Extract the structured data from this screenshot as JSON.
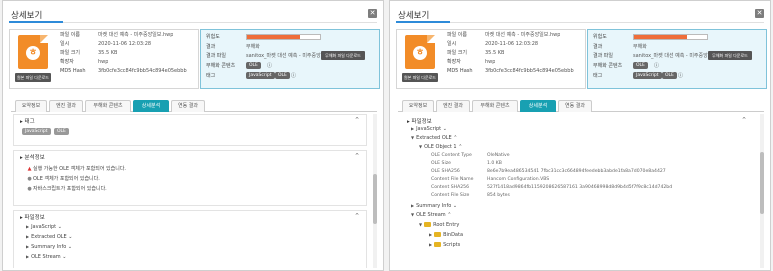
{
  "window_title": "상세보기",
  "file_info": {
    "icon_letter": "ㅎ",
    "download_label": "원본 파일 다운로드",
    "rows": [
      {
        "key": "파일 이름",
        "value": "마켓 대선 예측 - 미주중앙일보.hwp"
      },
      {
        "key": "일시",
        "value": "2020-11-06 12:03:28"
      },
      {
        "key": "파일 크기",
        "value": "35.5 KB"
      },
      {
        "key": "확장자",
        "value": "hwp"
      },
      {
        "key": "MD5 Hash",
        "value": "3fb0cfe3cc84fc9bb54c894e05ebbb"
      }
    ]
  },
  "result_info": {
    "risk_label": "위험도",
    "risk_level": 0.72,
    "rows": [
      {
        "key": "결과",
        "value": "무해화"
      },
      {
        "key": "결과 파일",
        "value": "sanitox_마켓 대선 예측 - 미주중앙..."
      },
      {
        "key": "무해화 콘텐츠",
        "value": "OLE"
      },
      {
        "key": "태그",
        "value": "JavaScript"
      }
    ],
    "result_download_label": "무해화 파일 다운로드",
    "tag_chip_2": "OLE"
  },
  "tabs": [
    "요약정보",
    "엔진 결과",
    "무해화 콘텐츠",
    "상세분석",
    "연동 결과"
  ],
  "active_tab": 3,
  "left_detail": {
    "tags_title": "태그",
    "tags": [
      "JavaScript",
      "OLE"
    ],
    "analysis_title": "분석정보",
    "analysis_items": [
      "실행 가능한 OLE 객체가 포함되어 있습니다.",
      "OLE 객체가 포함되어 있습니다.",
      "자바스크립트가 포함되어 있습니다."
    ],
    "file_info_title": "파일정보",
    "tree": [
      "JavaScript",
      "Extracted OLE",
      "Summary Info",
      "OLE Stream"
    ]
  },
  "right_detail": {
    "file_info_title": "파일정보",
    "javascript": "JavaScript",
    "extracted_ole": "Extracted OLE",
    "ole_object": "OLE Object 1",
    "props": [
      {
        "k": "OLE Content Type",
        "v": "OleNative"
      },
      {
        "k": "OLE Size",
        "v": "1.0 KB"
      },
      {
        "k": "OLE SHA256",
        "v": "8e6e7b9ea486534541 7fbc31cc3c664894feedebb3abde1fa8a7d070e8a4427"
      },
      {
        "k": "Content File Name",
        "v": "Hancom Configuration.VBS"
      },
      {
        "k": "Content SHA256",
        "v": "527f1418ad9864fb1159208626587161 3a90468998d8d9b4d5f7f9c8c14d742bd"
      },
      {
        "k": "Content File Size",
        "v": "854 bytes"
      }
    ],
    "summary_info": "Summary Info",
    "ole_stream": "OLE Stream",
    "root_entry": "Root Entry",
    "children": [
      "BinData",
      "Scripts"
    ]
  }
}
